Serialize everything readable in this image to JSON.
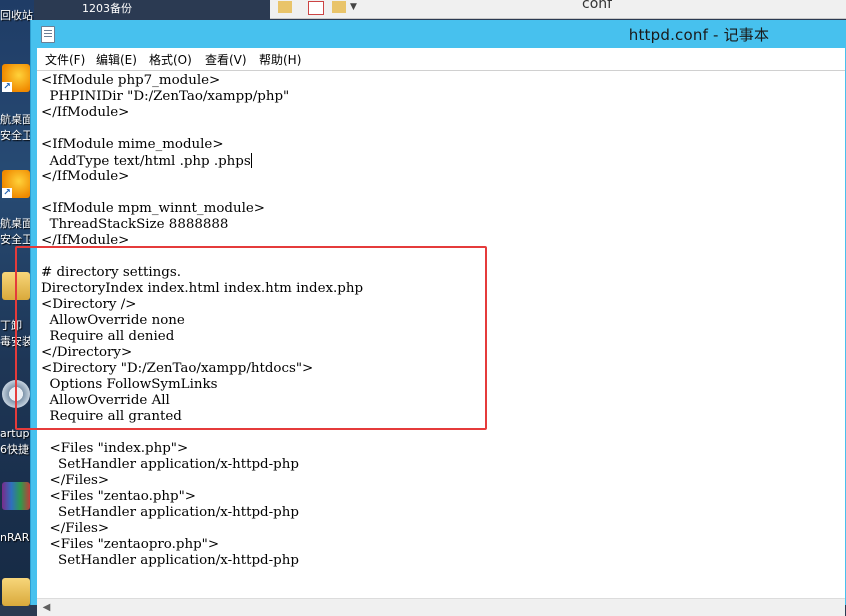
{
  "desktop": {
    "top_labels": [
      "回收站",
      "1203备份"
    ],
    "labels": [
      "航桌面",
      "安全卫",
      "航桌面",
      "安全卫",
      "丁卸",
      "毒安装",
      "artup",
      "6快捷",
      "nRAR"
    ]
  },
  "background_window": {
    "folder_title": "conf"
  },
  "window": {
    "title": "httpd.conf - 记事本"
  },
  "menu": {
    "items": [
      "文件(F)",
      "编辑(E)",
      "格式(O)",
      "查看(V)",
      "帮助(H)"
    ]
  },
  "editor": {
    "lines": [
      "<IfModule php7_module>",
      "  PHPINIDir \"D:/ZenTao/xampp/php\"",
      "</IfModule>",
      "",
      "<IfModule mime_module>",
      "  AddType text/html .php .phps",
      "</IfModule>",
      "",
      "<IfModule mpm_winnt_module>",
      "  ThreadStackSize 8888888",
      "</IfModule>",
      "",
      "# directory settings.",
      "DirectoryIndex index.html index.htm index.php",
      "<Directory />",
      "  AllowOverride none",
      "  Require all denied",
      "</Directory>",
      "<Directory \"D:/ZenTao/xampp/htdocs\">",
      "  Options FollowSymLinks",
      "  AllowOverride All",
      "  Require all granted",
      "",
      "  <Files \"index.php\">",
      "    SetHandler application/x-httpd-php",
      "  </Files>",
      "  <Files \"zentao.php\">",
      "    SetHandler application/x-httpd-php",
      "  </Files>",
      "  <Files \"zentaopro.php\">",
      "    SetHandler application/x-httpd-php"
    ]
  },
  "colors": {
    "title_bar": "#47c1ee",
    "highlight_border": "#e53b3b"
  }
}
